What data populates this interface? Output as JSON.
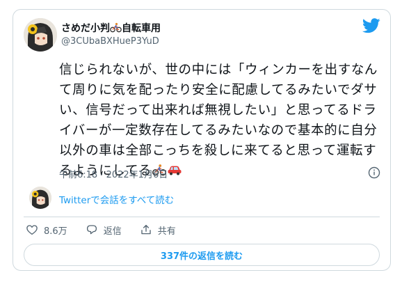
{
  "author": {
    "display_name": "さめだ小判",
    "display_name_suffix": "自転車用",
    "handle": "@3CUbaBXHueP3YuD"
  },
  "tweet": {
    "text": "信じられないが、世の中には「ウィンカーを出すなんて周りに気を配ったり安全に配慮してるみたいでダサい、信号だって出来れば無視したい」と思ってるドライバーが一定数存在してるみたいなので基本的に自分以外の車は全部こっちを殺しに来てると思って運転するようにしてる",
    "timestamp": "午前6:18 · 2022年1月6日"
  },
  "thread": {
    "label": "Twitterで会話をすべて読む"
  },
  "actions": {
    "likes": "8.6万",
    "reply_label": "返信",
    "share_label": "共有"
  },
  "replies_button": {
    "label": "337件の返信を読む"
  },
  "icons": {
    "brand": "twitter-bird-icon",
    "info": "info-icon",
    "like": "heart-icon",
    "reply": "speech-bubble-icon",
    "share": "share-icon",
    "bike": "bicycle-emoji-icon",
    "car": "car-emoji-icon"
  },
  "colors": {
    "accent": "#1d9bf0",
    "text": "#0f1419",
    "muted": "#536471",
    "border": "#cfd9de"
  }
}
